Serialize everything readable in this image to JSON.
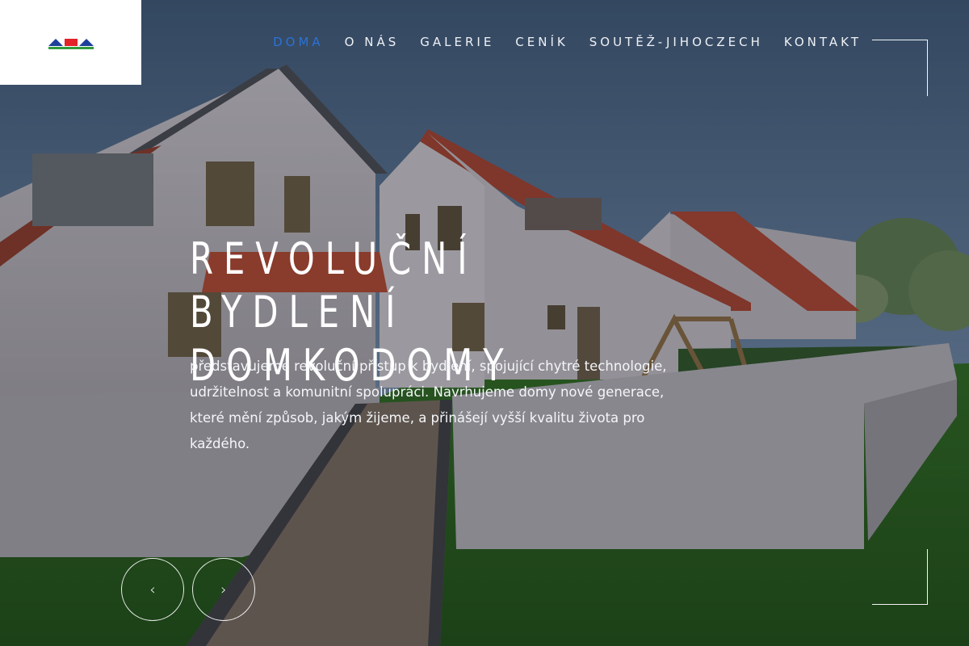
{
  "colors": {
    "accent": "#2a72d6",
    "nav_text": "#eef1f5",
    "logo_red": "#e3222a",
    "logo_blue": "#1f3f9c",
    "logo_green": "#2f9b3a"
  },
  "logo": {
    "icon": "logo-roofs-icon"
  },
  "nav": {
    "items": [
      {
        "label": "DOMA",
        "active": true
      },
      {
        "label": "O NÁS"
      },
      {
        "label": "GALERIE"
      },
      {
        "label": "CENÍK"
      },
      {
        "label": "SOUTĚŽ-JIHOCZECH"
      },
      {
        "label": "KONTAKT"
      }
    ]
  },
  "hero": {
    "headline_line1": "REVOLUČNÍ BYDLENÍ",
    "headline_line2": "DOMKODOMY",
    "text": "představujeme revoluční přístup k bydlení, spojující chytré technologie, udržitelnost a komunitní spolupráci.  Navrhujeme domy nové generace, které mění způsob, jakým žijeme, a přinášejí vyšší kvalitu života pro každého."
  },
  "slider": {
    "prev_icon": "chevron-left-icon",
    "next_icon": "chevron-right-icon",
    "prev_glyph": "‹",
    "next_glyph": "›"
  }
}
